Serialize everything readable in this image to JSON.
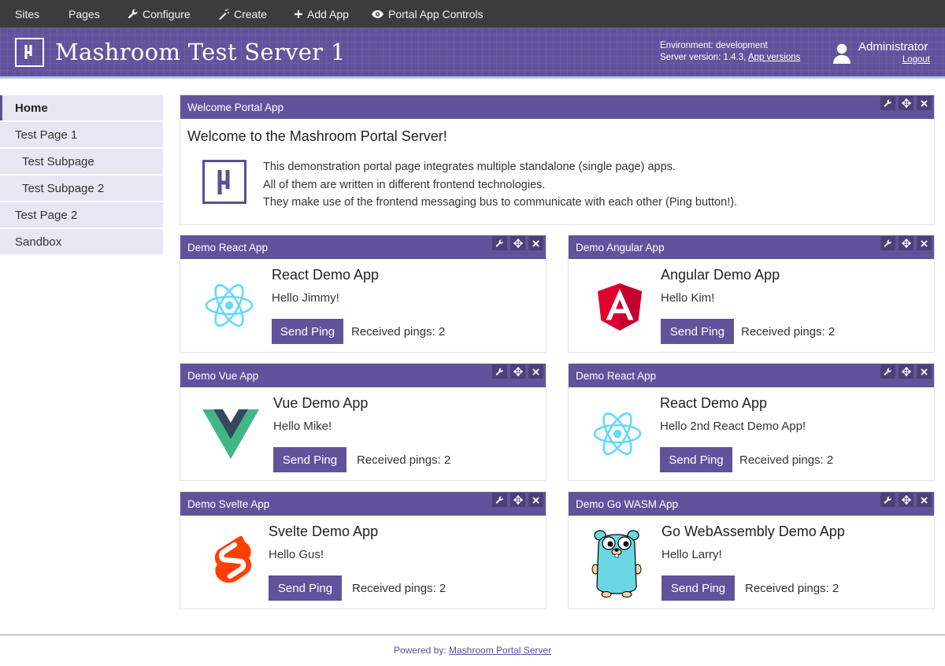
{
  "topbar": {
    "sites": "Sites",
    "pages": "Pages",
    "configure": "Configure",
    "create": "Create",
    "add_app": "Add App",
    "portal_app_controls": "Portal App Controls"
  },
  "header": {
    "logo_glyph": "μ",
    "title": "Mashroom Test Server 1",
    "environment": "Environment: development",
    "server_version": "Server version: 1.4.3, ",
    "app_versions_link": "App versions",
    "user": "Administrator",
    "logout": "Logout"
  },
  "sidebar": {
    "items": [
      {
        "label": "Home",
        "active": true
      },
      {
        "label": "Test Page 1"
      },
      {
        "label": "Test Subpage"
      },
      {
        "label": "Test Subpage 2"
      },
      {
        "label": "Test Page 2"
      },
      {
        "label": "Sandbox"
      }
    ]
  },
  "welcome": {
    "header": "Welcome Portal App",
    "title": "Welcome to the Mashroom Portal Server!",
    "line1": "This demonstration portal page integrates multiple standalone (single page) apps.",
    "line2": "All of them are written in different frontend technologies.",
    "line3": "They make use of the frontend messaging bus to communicate with each other (Ping button!)."
  },
  "apps": [
    {
      "header": "Demo React App",
      "title": "React Demo App",
      "hello": "Hello Jimmy!",
      "button": "Send Ping",
      "pings": "Received pings: 2",
      "icon": "react-logo-icon"
    },
    {
      "header": "Demo Angular App",
      "title": "Angular Demo App",
      "hello": "Hello Kim!",
      "button": "Send Ping",
      "pings": "Received pings: 2",
      "icon": "angular-logo-icon"
    },
    {
      "header": "Demo Vue App",
      "title": "Vue Demo App",
      "hello": "Hello Mike!",
      "button": "Send Ping",
      "pings": "Received pings: 2",
      "icon": "vue-logo-icon"
    },
    {
      "header": "Demo React App",
      "title": "React Demo App",
      "hello": "Hello 2nd React Demo App!",
      "button": "Send Ping",
      "pings": "Received pings: 2",
      "icon": "react-logo-icon"
    },
    {
      "header": "Demo Svelte App",
      "title": "Svelte Demo App",
      "hello": "Hello Gus!",
      "button": "Send Ping",
      "pings": "Received pings: 2",
      "icon": "svelte-logo-icon"
    },
    {
      "header": "Demo Go WASM App",
      "title": "Go WebAssembly Demo App",
      "hello": "Hello Larry!",
      "button": "Send Ping",
      "pings": "Received pings: 2",
      "icon": "go-gopher-icon"
    }
  ],
  "footer": {
    "powered_by": "Powered by: ",
    "link": "Mashroom Portal Server"
  },
  "colors": {
    "brand": "#61539b",
    "topbar": "#3c3c3c",
    "sidebar": "#e8e6f3",
    "react": "#61dafb",
    "angular": "#dd0031",
    "vue_green": "#41b883",
    "vue_dark": "#34495e",
    "svelte": "#ff3e00",
    "gopher": "#6ad7e5"
  }
}
